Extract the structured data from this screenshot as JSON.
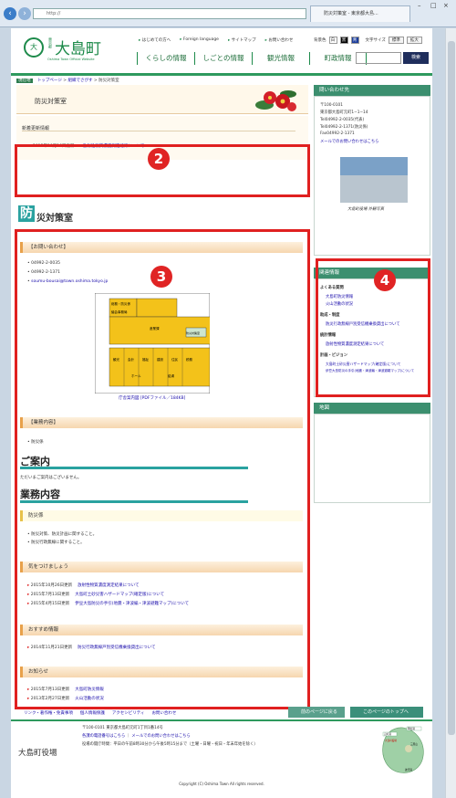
{
  "browser": {
    "address": "http://",
    "tab": "防災対策室 - 東京都大島..."
  },
  "header": {
    "seal": "大",
    "sub": "東京都",
    "title": "大島町",
    "en": "Oshima Town Official Website",
    "links": [
      "はじめての方へ",
      "Foreign language",
      "サイトマップ",
      "お問い合わせ"
    ],
    "bg_label": "背景色",
    "bg": [
      "白",
      "黒",
      "青"
    ],
    "size_label": "文字サイズ",
    "sizes": [
      "標準",
      "拡大"
    ],
    "nav": [
      "くらしの情報",
      "しごとの情報",
      "観光情報",
      "町政情報"
    ],
    "search_btn": "検索"
  },
  "breadcrumb": {
    "tag": "現在地",
    "home": "トップページ",
    "mid": "組織でさがす",
    "current": "防災対策室"
  },
  "page_title": "防災対策室",
  "news": {
    "heading": "新着更新情報",
    "date": "2015年10月26日更新",
    "link": "放射性物質濃度測定結果について"
  },
  "h1": {
    "kanji": "防",
    "rest": "災対策室"
  },
  "contact": {
    "heading": "【お問い合わせ】",
    "phone1": "04992-2-0035",
    "phone2": "04992-2-1371",
    "email": "soumu-bousai@town.oshima.tokyo.jp",
    "map_caption": "庁舎案内図 [PDFファイル／184KB]",
    "rooms": [
      "総務・防災係",
      "議会事務局",
      "産業課",
      "防災対策室",
      "観光",
      "会計",
      "福祉",
      "建設",
      "住民",
      "税務",
      "ホール",
      "給湯"
    ]
  },
  "work": {
    "heading": "【業務内容】",
    "item": "防災係"
  },
  "guide": {
    "title": "ご案内",
    "text": "ただいまご案内はございません。"
  },
  "duties": {
    "title": "業務内容",
    "sub": "防災係",
    "items": [
      "防災対策、防災計画に関すること。",
      "防災行政無線に関すること。"
    ]
  },
  "caution": {
    "heading": "気をつけましょう",
    "rows": [
      {
        "date": "2015年10月26日更新",
        "link": "放射性物質濃度測定結果について"
      },
      {
        "date": "2015年7月13日更新",
        "link": "大島町土砂災害ハザードマップ(確定版)について"
      },
      {
        "date": "2015年4月15日更新",
        "link": "伊豆大島防災の手引(地震・津波編・津波避難マップ)について"
      }
    ]
  },
  "recommend": {
    "heading": "おすすめ情報",
    "rows": [
      {
        "date": "2014年11月21日更新",
        "link": "防災行政無線戸別受信機乗換貸出について"
      }
    ]
  },
  "notice": {
    "heading": "お知らせ",
    "rows": [
      {
        "date": "2015年7月13日更新",
        "link": "大島町防災情報"
      },
      {
        "date": "2013年2月27日更新",
        "link": "火山活動の状況"
      }
    ]
  },
  "side_contact": {
    "heading": "問い合わせ先",
    "lines": [
      "〒100-0101",
      "東京都大島町元町1−1−14",
      "Tel04992-2-0035(代表)",
      "Tel04992-2-1371(防災係)",
      "Fax04992-2-1371"
    ],
    "mail": "メールでのお問い合わせはこちら",
    "photo_caption": "大島町役場 外観写真"
  },
  "related": {
    "heading": "関連情報",
    "groups": [
      {
        "title": "よくある質問",
        "links": [
          "大島町防災情報",
          "火山活動の状況"
        ]
      },
      {
        "title": "助成・制度",
        "links": [
          "防災行政無線戸別受信機乗換貸出について"
        ]
      },
      {
        "title": "統計情報",
        "links": [
          "放射性物質濃度測定結果について"
        ]
      },
      {
        "title": "計画・ビジョン",
        "links": [
          "大島町土砂災害ハザードマップ(確定版)について",
          "伊豆大島防災の手引(地震・津波編・津波避難マップ)について"
        ]
      }
    ]
  },
  "map_heading": "地図",
  "callouts": [
    "2",
    "3",
    "4"
  ],
  "footer": {
    "links": [
      "リンク・著作権・免責事項",
      "個人情報保護",
      "アクセシビリティ",
      "お問い合わせ"
    ],
    "prev": "前のページに戻る",
    "top": "このページのトップへ",
    "name": "大島町役場",
    "addr1": "〒100-0101 東京都大島町元町1丁目1番14号",
    "addr2a": "各課の電話番号はこちら",
    "addr2b": "メールでのお問い合わせはこちら",
    "addr3": "役場の開庁時間：平日の午前8時30分から午後5時15分まで（土曜・日曜・祝日・年末年始を除く）",
    "mapnames": [
      "岡田港",
      "元町港",
      "大島町役場",
      "三原山",
      "波浮港"
    ],
    "copy": "Copyright (C) Oshima Town All rights reserved."
  }
}
